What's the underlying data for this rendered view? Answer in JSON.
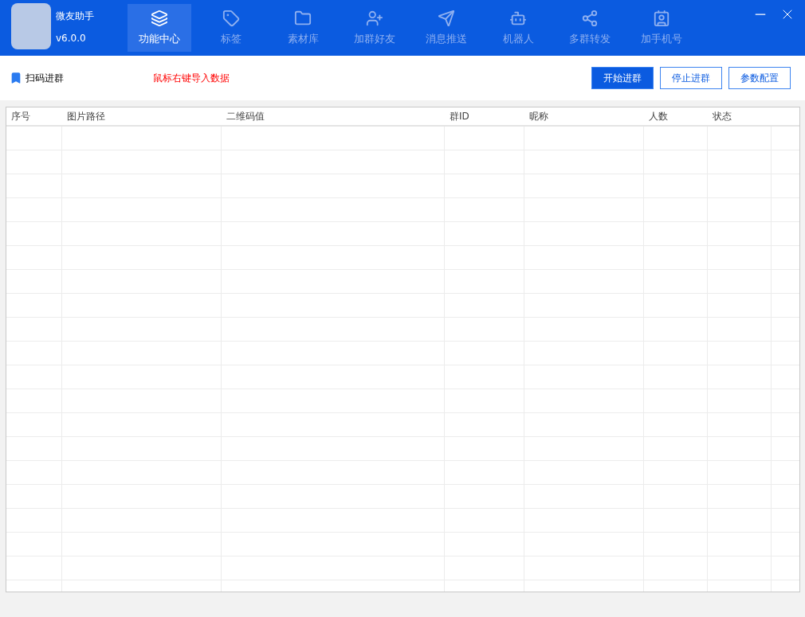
{
  "app": {
    "name": "微友助手",
    "version": "v6.0.0"
  },
  "nav": [
    {
      "kind": "layers",
      "label": "功能中心",
      "selected": true
    },
    {
      "kind": "tag",
      "label": "标签",
      "selected": false
    },
    {
      "kind": "folder",
      "label": "素材库",
      "selected": false
    },
    {
      "kind": "user-plus",
      "label": "加群好友",
      "selected": false
    },
    {
      "kind": "send",
      "label": "消息推送",
      "selected": false
    },
    {
      "kind": "robot",
      "label": "机器人",
      "selected": false
    },
    {
      "kind": "share",
      "label": "多群转发",
      "selected": false
    },
    {
      "kind": "contact",
      "label": "加手机号",
      "selected": false
    }
  ],
  "toolbar": {
    "title": "扫码进群",
    "hint": "鼠标右键导入数据",
    "buttons": [
      {
        "label": "开始进群",
        "primary": true
      },
      {
        "label": "停止进群",
        "primary": false
      },
      {
        "label": "参数配置",
        "primary": false
      }
    ]
  },
  "table": {
    "columns": [
      "序号",
      "图片路径",
      "二维码值",
      "群ID",
      "昵称",
      "人数",
      "状态"
    ]
  }
}
